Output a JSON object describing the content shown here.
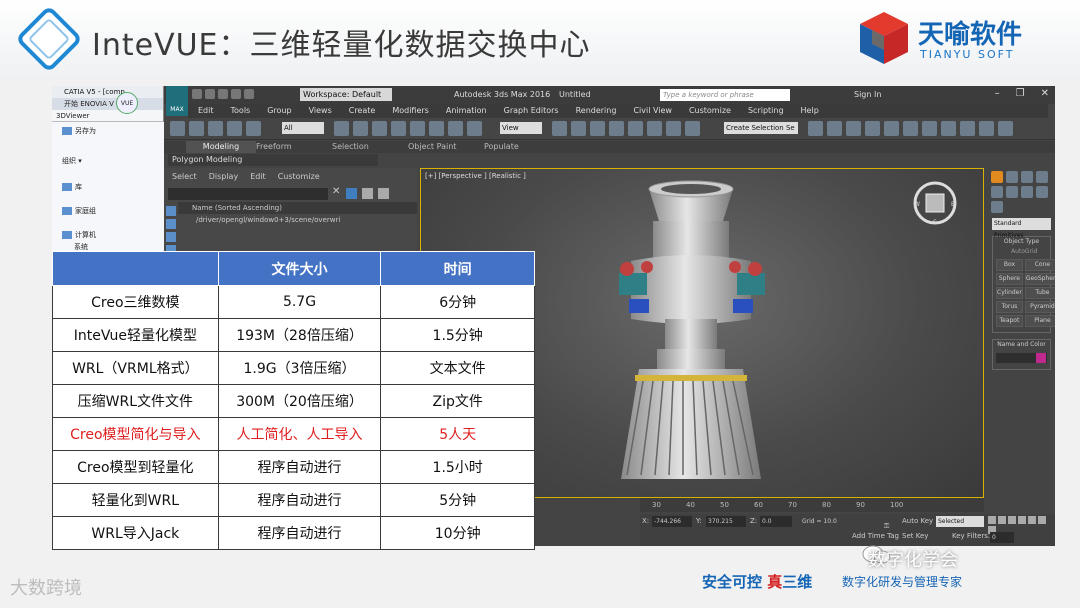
{
  "slide": {
    "title": "InteVUE：三维轻量化数据交换中心",
    "brand_name": "天喻软件",
    "brand_sub": "TIANYU SOFT",
    "tagline_a": "安全可控 ",
    "tagline_red": "真",
    "tagline_b": "三维",
    "tagline_sub": "数字化研发与管理专家",
    "watermark": "大数跨境",
    "wechat": "数字化学会"
  },
  "catia": {
    "title": "CATIA V5 - [comp",
    "bar2": "开始  ENOVIA V",
    "tab": "3DViewer",
    "badge": "VUE",
    "items": [
      "另存为",
      "组织 ▾",
      "库",
      "家庭组",
      "计算机",
      "系统"
    ]
  },
  "max": {
    "workspace": "Workspace: Default",
    "app_title": "Autodesk 3ds Max 2016",
    "file_title": "Untitled",
    "search_placeholder": "Type a keyword or phrase",
    "sign_in": "Sign In",
    "logo": "MAX",
    "menu": [
      "Edit",
      "Tools",
      "Group",
      "Views",
      "Create",
      "Modifiers",
      "Animation",
      "Graph Editors",
      "Rendering",
      "Civil View",
      "Customize",
      "Scripting",
      "Help"
    ],
    "dropdown_all": "All",
    "dropdown_view": "View",
    "dropdown_selection": "Create Selection Se",
    "ribbon_tabs": [
      "Modeling",
      "Freeform",
      "Selection",
      "Object Paint",
      "Populate"
    ],
    "ribbon_sub": "Polygon Modeling",
    "scene_menu": [
      "Select",
      "Display",
      "Edit",
      "Customize"
    ],
    "scene_header": "Name (Sorted Ascending)",
    "scene_row": "/driver/opengl/window0+3/scene/overwri",
    "viewport_label": "[+] [Perspective ] [Realistic ]",
    "cmd_dropdown": "Standard Primitives",
    "object_type": "Object Type",
    "autogrid": "AutoGrid",
    "primitives": [
      "Box",
      "Cone",
      "Sphere",
      "GeoSphere",
      "Cylinder",
      "Tube",
      "Torus",
      "Pyramid",
      "Teapot",
      "Plane"
    ],
    "name_color": "Name and Color",
    "timeline": [
      "30",
      "40",
      "50",
      "60",
      "70",
      "80",
      "90",
      "100"
    ],
    "x_val": "-744.266",
    "y_val": "370.215",
    "z_val": "0.0",
    "grid": "Grid = 10.0",
    "add_time_tag": "Add Time Tag",
    "auto_key": "Auto Key",
    "selected": "Selected",
    "set_key": "Set Key",
    "key_filters": "Key Filters...",
    "frame": "0"
  },
  "table": {
    "headers": [
      "",
      "文件大小",
      "时间"
    ],
    "rows": [
      [
        "Creo三维数模",
        "5.7G",
        "6分钟"
      ],
      [
        "InteVue轻量化模型",
        "193M（28倍压缩）",
        "1.5分钟"
      ],
      [
        "WRL（VRML格式）",
        "1.9G（3倍压缩）",
        "文本文件"
      ],
      [
        "压缩WRL文件文件",
        "300M（20倍压缩）",
        "Zip文件"
      ],
      [
        "Creo模型简化与导入",
        "人工简化、人工导入",
        "5人天"
      ],
      [
        "Creo模型到轻量化",
        "程序自动进行",
        "1.5小时"
      ],
      [
        "轻量化到WRL",
        "程序自动进行",
        "5分钟"
      ],
      [
        "WRL导入Jack",
        "程序自动进行",
        "10分钟"
      ]
    ],
    "highlight_row": 4,
    "highlight_color": "#e02020",
    "header_color": "#4472c4"
  },
  "colors": {
    "accent_blue": "#1565b5",
    "max_bg": "#444444",
    "viewport_border": "#d8b200"
  }
}
